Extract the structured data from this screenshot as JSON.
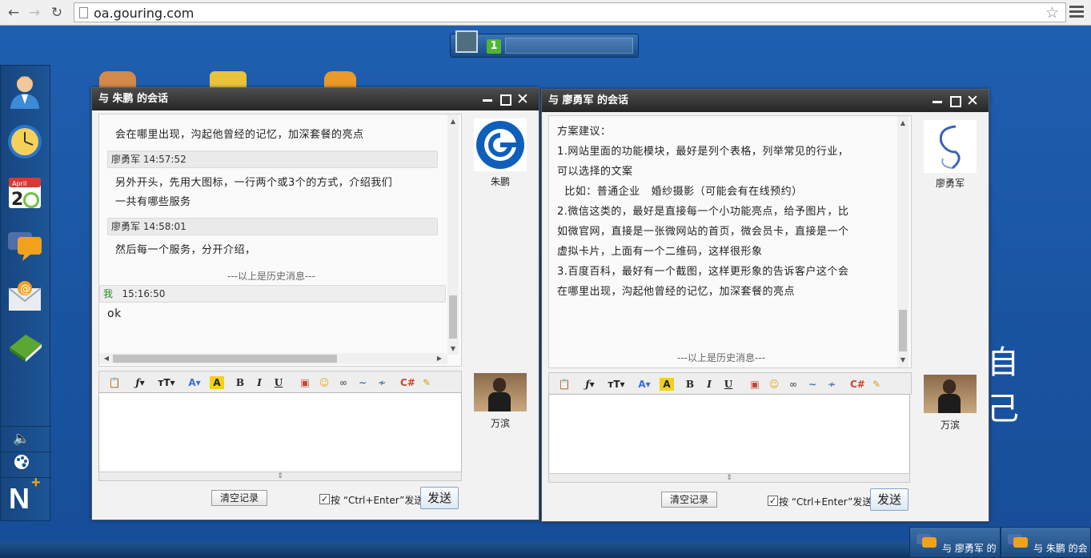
{
  "browser": {
    "url": "oa.gouring.com"
  },
  "desktop": {
    "text": "自 己",
    "user_widget_badge": "1"
  },
  "dock": {
    "items": [
      "user-icon",
      "clock-icon",
      "calendar-icon",
      "chat-icon",
      "mail-icon",
      "book-icon"
    ],
    "bottom": [
      "volume-icon",
      "palette-icon",
      "logo-icon"
    ],
    "calendar_month": "April",
    "calendar_day": "2"
  },
  "win1": {
    "title": "与 朱鹏 的会话",
    "history": [
      {
        "type": "text",
        "text": "会在哪里出现，沟起他曾经的记忆，加深套餐的亮点"
      },
      {
        "type": "head",
        "text": "廖勇军 14:57:52"
      },
      {
        "type": "text",
        "text": "另外开头，先用大图标，一行两个或3个的方式，介绍我们"
      },
      {
        "type": "text",
        "text": "一共有哪些服务"
      },
      {
        "type": "head",
        "text": "廖勇军 14:58:01"
      },
      {
        "type": "text",
        "text": "然后每一个服务，分开介绍，"
      }
    ],
    "separator": "---以上是历史消息---",
    "my_sender": "我",
    "my_time": "15:16:50",
    "my_message": "ok",
    "contact_name": "朱鹏",
    "me_name": "万滨",
    "clear_label": "清空记录",
    "ctrl_enter_label": "按 “Ctrl+Enter”发送",
    "send_label": "发送"
  },
  "win2": {
    "title": "与 廖勇军 的会话",
    "history": [
      "方案建议：",
      "1.网站里面的功能模块，最好是列个表格，列举常见的行业，",
      "可以选择的文案",
      "  比如：普通企业   婚纱摄影（可能会有在线预约）",
      "2.微信这类的，最好是直接每一个小功能亮点，给予图片，比",
      "如微官网，直接是一张微网站的首页，微会员卡，直接是一个",
      "虚拟卡片，上面有一个二维码，这样很形象",
      "3.百度百科，最好有一个截图，这样更形象的告诉客户这个会",
      "在哪里出现，沟起他曾经的记忆，加深套餐的亮点"
    ],
    "separator": "---以上是历史消息---",
    "contact_name": "廖勇军",
    "me_name": "万滨",
    "clear_label": "清空记录",
    "ctrl_enter_label": "按 “Ctrl+Enter”发送",
    "send_label": "发送"
  },
  "taskbar": {
    "items": [
      "与 廖勇军 的",
      "与 朱鹏 的会"
    ]
  },
  "colors": {
    "desktop": "#1d5aa5",
    "titlebar": "#333333",
    "send_border": "#7fa4c9"
  }
}
